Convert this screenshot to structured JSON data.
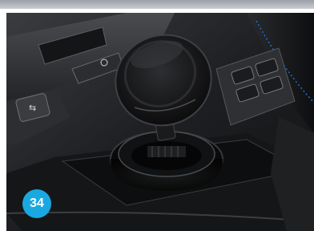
{
  "badge": {
    "number": "34",
    "color": "#19a9e0"
  },
  "photo": {
    "subject": "ashtray-open-in-car-center-console"
  }
}
